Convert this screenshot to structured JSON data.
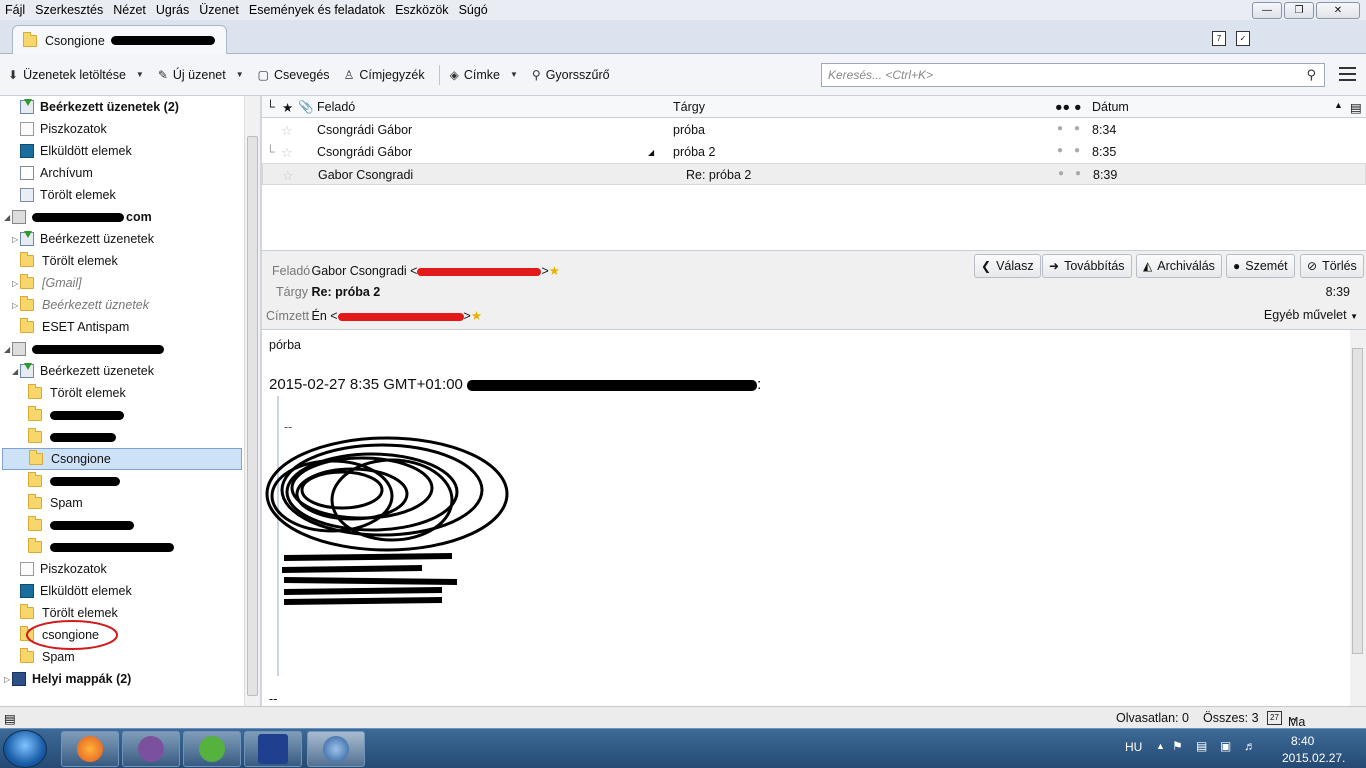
{
  "menu": [
    "Fájl",
    "Szerkesztés",
    "Nézet",
    "Ugrás",
    "Üzenet",
    "Események és feladatok",
    "Eszközök",
    "Súgó"
  ],
  "tab": {
    "label": "Csongione"
  },
  "toolbar": {
    "get_mail": "Üzenetek letöltése",
    "write": "Új üzenet",
    "chat": "Csevegés",
    "address_book": "Címjegyzék",
    "tag": "Címke",
    "quick_filter": "Gyorsszűrő",
    "search_placeholder": "Keresés... <Ctrl+K>"
  },
  "folders": [
    {
      "label": "Beérkezett üzenetek (2)",
      "type": "inbox"
    },
    {
      "label": "Piszkozatok",
      "type": "draft"
    },
    {
      "label": "Elküldött elemek",
      "type": "sent"
    },
    {
      "label": "Archívum",
      "type": "arch"
    },
    {
      "label": "Törölt elemek",
      "type": "trash"
    },
    {
      "label": "com",
      "type": "acct"
    },
    {
      "label": "Beérkezett üzenetek",
      "type": "inbox"
    },
    {
      "label": "Törölt elemek",
      "type": "folder"
    },
    {
      "label": "[Gmail]",
      "type": "folder"
    },
    {
      "label": "Beérkezett üznetek",
      "type": "folder"
    },
    {
      "label": "ESET Antispam",
      "type": "folder"
    },
    {
      "label": "",
      "type": "acct"
    },
    {
      "label": "Beérkezett üzenetek",
      "type": "inbox"
    },
    {
      "label": "Törölt elemek",
      "type": "folder"
    },
    {
      "label": "",
      "type": "folder"
    },
    {
      "label": "",
      "type": "folder"
    },
    {
      "label": "Csongione",
      "type": "folder"
    },
    {
      "label": "",
      "type": "folder"
    },
    {
      "label": "Spam",
      "type": "folder"
    },
    {
      "label": "",
      "type": "folder"
    },
    {
      "label": "",
      "type": "folder"
    },
    {
      "label": "Piszkozatok",
      "type": "draft"
    },
    {
      "label": "Elküldött elemek",
      "type": "sent"
    },
    {
      "label": "Törölt elemek",
      "type": "folder"
    },
    {
      "label": "csongione",
      "type": "folder"
    },
    {
      "label": "Spam",
      "type": "folder"
    },
    {
      "label": "Helyi mappák (2)",
      "type": "local"
    }
  ],
  "columns": {
    "from": "Feladó",
    "subject": "Tárgy",
    "date": "Dátum"
  },
  "messages": [
    {
      "from": "Csongrádi Gábor",
      "subject": "próba",
      "date": "8:34"
    },
    {
      "from": "Csongrádi Gábor",
      "subject": "próba 2",
      "date": "8:35"
    },
    {
      "from": "Gabor Csongradi",
      "subject": "Re: próba 2",
      "date": "8:39"
    }
  ],
  "header": {
    "from_label": "Feladó",
    "from_value": "Gabor Csongradi <",
    "from_close": ">",
    "subject_label": "Tárgy",
    "subject_value": "Re: próba 2",
    "time": "8:39",
    "to_label": "Címzett",
    "to_value": "Én <",
    "to_close": ">",
    "other_actions": "Egyéb művelet",
    "reply": "Válasz",
    "forward": "Továbbítás",
    "archive": "Archiválás",
    "junk": "Szemét",
    "delete": "Törlés"
  },
  "body": {
    "line1": "pórba",
    "quote_intro": "2015-02-27 8:35 GMT+01:00",
    "dashes": "--"
  },
  "status": {
    "unread": "Olvasatlan: 0",
    "total": "Összes: 3",
    "today_panel": "Ma panel",
    "calendar_day": "27"
  },
  "tray": {
    "lang": "HU",
    "time": "8:40",
    "date": "2015.02.27."
  }
}
